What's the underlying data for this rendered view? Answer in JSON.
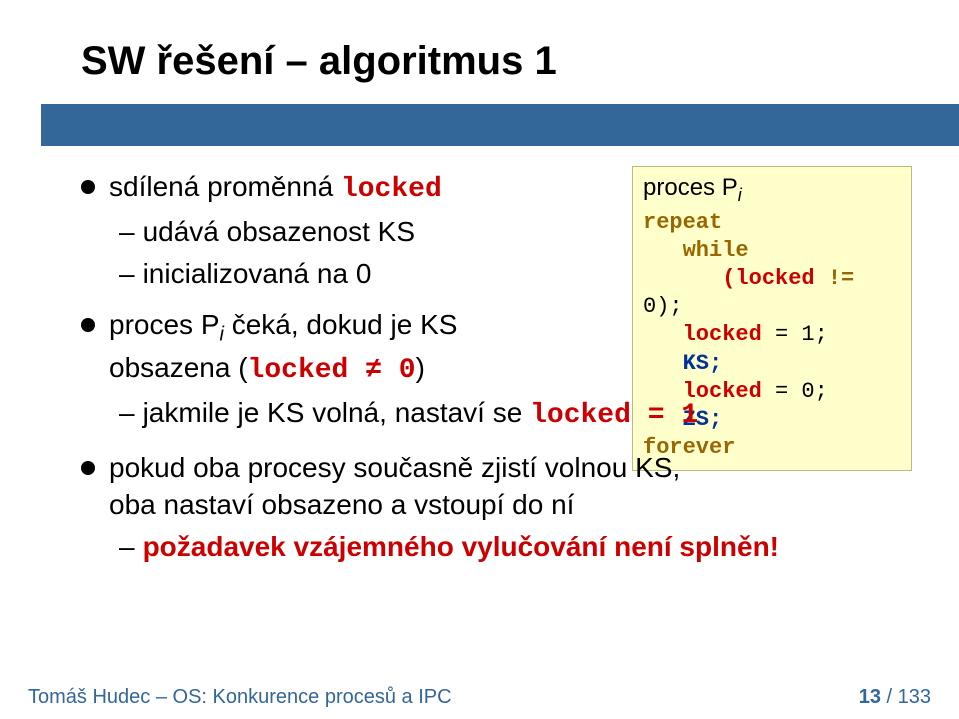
{
  "title": "SW řešení – algoritmus 1",
  "code": {
    "head_prefix": "proces P",
    "head_sub": "i",
    "l1": "repeat",
    "l2": "while",
    "l3a": "(locked ",
    "l3b": "!=",
    "l3c": " 0);",
    "l4a": "locked",
    "l4b": " = 1;",
    "l5": "KS;",
    "l6a": "locked",
    "l6b": " = 0;",
    "l7": "ZS;",
    "l8": "forever"
  },
  "bullets": [
    {
      "pre": "sdílená proměnná ",
      "code": "locked"
    },
    {
      "text": "udává obsazenost KS"
    },
    {
      "text": "inicializovaná na 0"
    },
    {
      "pre1": "proces P",
      "sub": "i",
      "pre2": " čeká, dokud je KS",
      "line2a": "obsazena (",
      "code": "locked ≠ 0",
      "line2b": ")"
    },
    {
      "pre": "jakmile je KS volná, nastaví se ",
      "code": "locked = 1"
    },
    {
      "line1": "pokud oba procesy současně zjistí volnou KS,",
      "line2": "oba nastaví obsazeno a vstoupí do ní"
    },
    {
      "text": "požadavek vzájemného vylučování není splněn!"
    }
  ],
  "footer": {
    "left": "Tomáš Hudec – OS: Konkurence procesů a IPC",
    "page_current": "13",
    "page_sep": " / ",
    "page_total": "133"
  }
}
